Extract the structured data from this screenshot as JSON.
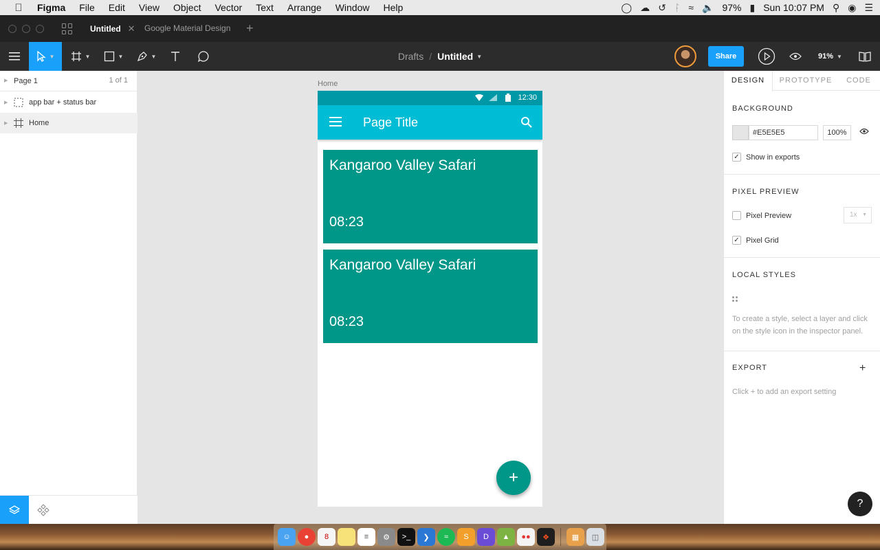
{
  "menubar": {
    "app_name": "Figma",
    "items": [
      "File",
      "Edit",
      "View",
      "Object",
      "Vector",
      "Text",
      "Arrange",
      "Window",
      "Help"
    ],
    "battery": "97%",
    "clock": "Sun 10:07 PM"
  },
  "tabs": {
    "active_label": "Untitled",
    "other_label": "Google Material Design"
  },
  "toolbar": {
    "crumb_drafts": "Drafts",
    "crumb_sep": "/",
    "file_name": "Untitled",
    "share_label": "Share",
    "zoom": "91%"
  },
  "left_panel": {
    "page_name": "Page 1",
    "page_count": "1 of 1",
    "layers": [
      "app bar + status bar",
      "Home"
    ]
  },
  "canvas": {
    "frame_label": "Home",
    "status_time": "12:30",
    "page_title": "Page Title",
    "cards": [
      {
        "title": "Kangaroo Valley Safari",
        "time": "08:23"
      },
      {
        "title": "Kangaroo Valley Safari",
        "time": "08:23"
      }
    ],
    "fab_label": "+"
  },
  "right_panel": {
    "tabs": [
      "DESIGN",
      "PROTOTYPE",
      "CODE"
    ],
    "background_title": "BACKGROUND",
    "bg_hex": "#E5E5E5",
    "bg_opacity": "100%",
    "show_in_exports": "Show in exports",
    "pixel_preview_title": "PIXEL PREVIEW",
    "pixel_preview_label": "Pixel Preview",
    "pixel_preview_scale": "1x",
    "pixel_grid_label": "Pixel Grid",
    "local_styles_title": "LOCAL STYLES",
    "local_styles_hint": "To create a style, select a layer and click on the style icon in the inspector panel.",
    "export_title": "EXPORT",
    "export_hint": "Click + to add an export setting",
    "help": "?"
  },
  "colors": {
    "accent": "#18a0fb",
    "status_bar": "#0097a7",
    "app_bar": "#00bcd4",
    "card": "#009688",
    "canvas_bg": "#e5e5e5"
  }
}
